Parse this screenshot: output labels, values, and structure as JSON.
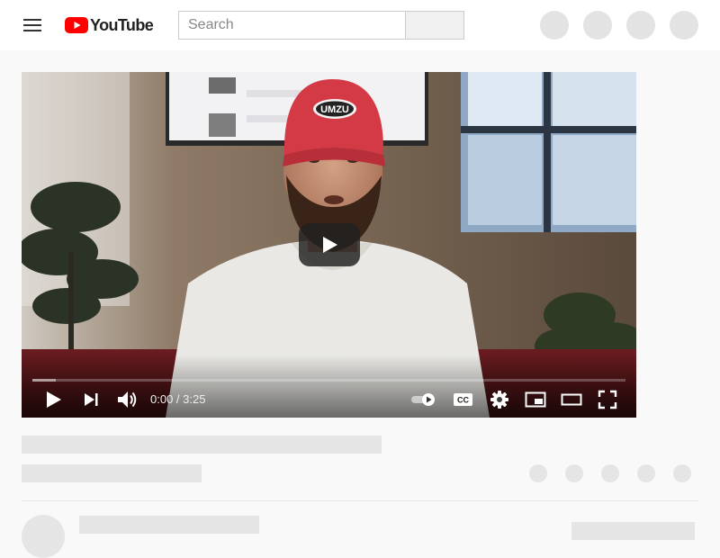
{
  "app": {
    "logo_text": "YouTube",
    "logo_color": "#ff0000"
  },
  "search": {
    "placeholder": "Search",
    "value": ""
  },
  "player": {
    "time_display": "0:00 / 3:25",
    "current_time": "0:00",
    "duration": "3:25",
    "progress_fraction": 0.0,
    "loaded_fraction": 0.04,
    "cap_text": "UMZU",
    "caption_badge": "CC"
  },
  "icons": {
    "menu": "menu-icon",
    "search": "search-icon",
    "play": "play-icon",
    "next": "next-icon",
    "volume": "volume-icon",
    "autoplay": "autoplay-toggle-icon",
    "captions": "captions-icon",
    "settings": "gear-icon",
    "miniplayer": "miniplayer-icon",
    "theater": "theater-icon",
    "fullscreen": "fullscreen-icon"
  }
}
